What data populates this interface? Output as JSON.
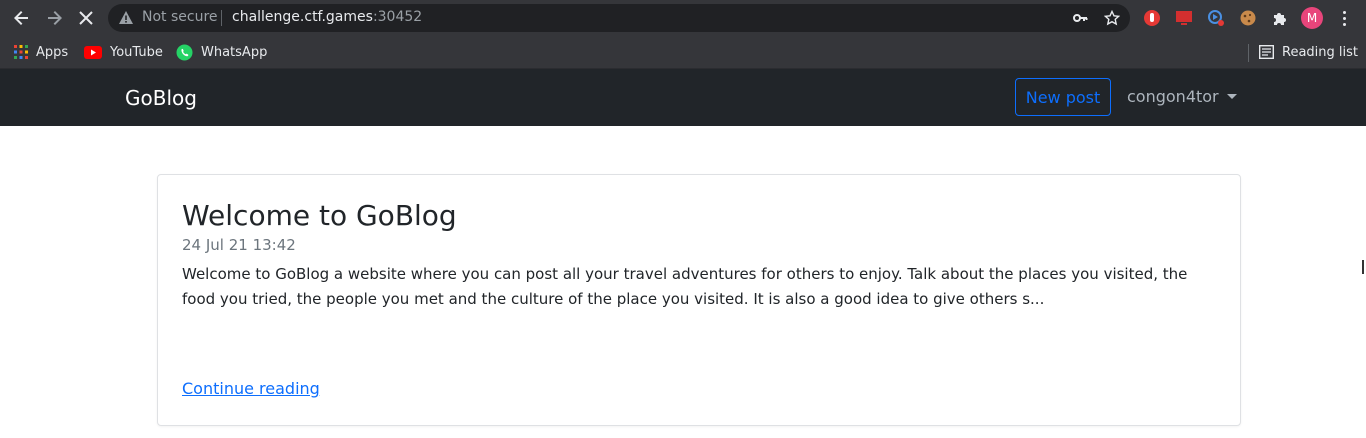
{
  "browser": {
    "security_label": "Not secure",
    "url_host": "challenge.ctf.games",
    "url_port": ":30452",
    "profile_initial": "M"
  },
  "bookmarks": {
    "items": [
      {
        "label": "Apps",
        "icon": "apps-grid-icon"
      },
      {
        "label": "YouTube",
        "icon": "youtube-icon"
      },
      {
        "label": "WhatsApp",
        "icon": "whatsapp-icon"
      }
    ],
    "reading_list": "Reading list"
  },
  "site": {
    "brand": "GoBlog",
    "new_post_label": "New post",
    "username": "congon4tor"
  },
  "post": {
    "title": "Welcome to GoBlog",
    "date": "24 Jul 21 13:42",
    "excerpt": "Welcome to GoBlog a website where you can post all your travel adventures for others to enjoy. Talk about the places you visited, the food you tried, the people you met and the culture of the place you visited. It is also a good idea to give others s...",
    "link_label": "Continue reading"
  },
  "colors": {
    "navbar_bg": "#212529",
    "accent": "#0d6efd",
    "profile_bg": "#e8457b"
  }
}
